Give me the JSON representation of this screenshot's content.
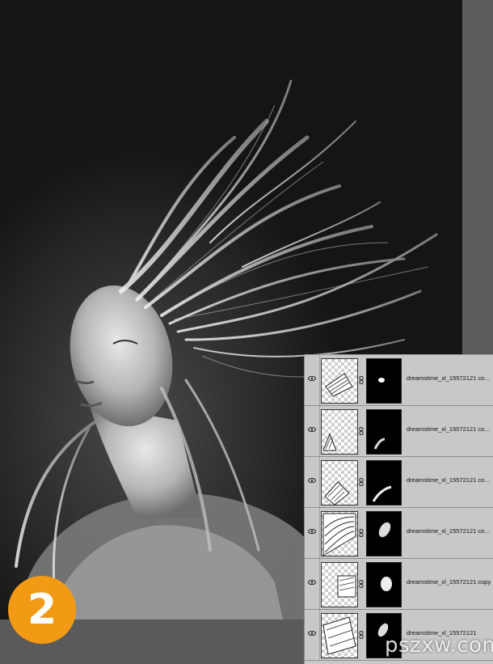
{
  "step": {
    "number": "2"
  },
  "watermark": {
    "text": "pszxw.com"
  },
  "colors": {
    "badge": "#f39a14",
    "panel": "#c8c8c8",
    "workspace": "#575757"
  },
  "layers_panel": {
    "layers": [
      {
        "name": "dreamstime_xl_15572121 co...",
        "visible": true
      },
      {
        "name": "dreamstime_xl_15572121 co...",
        "visible": true
      },
      {
        "name": "dreamstime_xl_15572121 co...",
        "visible": true
      },
      {
        "name": "dreamstime_xl_15572121 co...",
        "visible": true
      },
      {
        "name": "dreamstime_xl_15572121 copy",
        "visible": true
      },
      {
        "name": "dreamstime_xl_15572121",
        "visible": true
      }
    ]
  }
}
